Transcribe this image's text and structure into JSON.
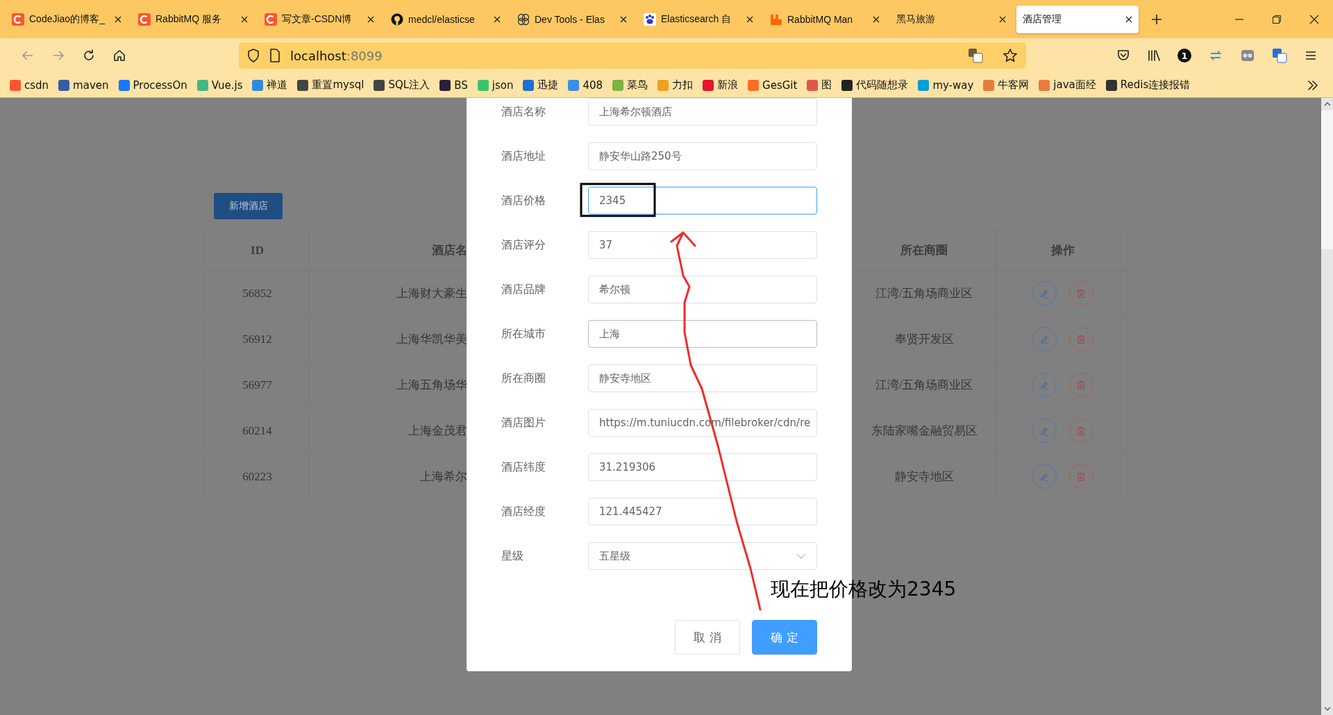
{
  "browser": {
    "tabs": [
      {
        "title": "CodeJiao的博客_",
        "kind": "csdn",
        "selected": false
      },
      {
        "title": "RabbitMQ 服务",
        "kind": "csdn",
        "selected": false
      },
      {
        "title": "写文章-CSDN博",
        "kind": "csdn",
        "selected": false
      },
      {
        "title": "medcl/elasticse",
        "kind": "github",
        "selected": false
      },
      {
        "title": "Dev Tools - Elas",
        "kind": "devtools",
        "selected": false
      },
      {
        "title": "Elasticsearch 自",
        "kind": "baidu",
        "selected": false
      },
      {
        "title": "RabbitMQ Man",
        "kind": "rabbit",
        "selected": false
      },
      {
        "title": "黑马旅游",
        "kind": "plain",
        "selected": false
      },
      {
        "title": "酒店管理",
        "kind": "plain",
        "selected": true
      }
    ],
    "address": {
      "host": "localhost",
      "port": ":8099"
    },
    "toolbar_badge": "1",
    "bookmarks": [
      {
        "label": "csdn",
        "color": "#fc5531"
      },
      {
        "label": "maven",
        "color": "#3a5ca8"
      },
      {
        "label": "ProcessOn",
        "color": "#1677ff"
      },
      {
        "label": "Vue.js",
        "color": "#41b883"
      },
      {
        "label": "禅道",
        "color": "#2f8bd8"
      },
      {
        "label": "重置mysql",
        "color": "#444444"
      },
      {
        "label": "SQL注入",
        "color": "#444444"
      },
      {
        "label": "BS",
        "color": "#2a1f3d"
      },
      {
        "label": "json",
        "color": "#3ac46a"
      },
      {
        "label": "迅捷",
        "color": "#1f6fd0"
      },
      {
        "label": "408",
        "color": "#3b8ee6"
      },
      {
        "label": "菜鸟",
        "color": "#7cb342"
      },
      {
        "label": "力扣",
        "color": "#f0a020"
      },
      {
        "label": "新浪",
        "color": "#e6162d"
      },
      {
        "label": "GesGit",
        "color": "#fc6d26"
      },
      {
        "label": "图",
        "color": "#e0564e"
      },
      {
        "label": "代码随想录",
        "color": "#222222"
      },
      {
        "label": "my-way",
        "color": "#00a1d6"
      },
      {
        "label": "牛客网",
        "color": "#e87c3e"
      },
      {
        "label": "java面经",
        "color": "#e87c3e"
      },
      {
        "label": "Redis连接报错",
        "color": "#333333"
      }
    ]
  },
  "page": {
    "add_button": "新增酒店",
    "table": {
      "columns": [
        "ID",
        "酒店名",
        "所在商圈",
        "操作"
      ],
      "rows": [
        {
          "id": "56852",
          "name": "上海财大豪生",
          "area": "江湾/五角场商业区"
        },
        {
          "id": "56912",
          "name": "上海华凯华美",
          "area": "奉贤开发区"
        },
        {
          "id": "56977",
          "name": "上海五角场华",
          "area": "江湾/五角场商业区"
        },
        {
          "id": "60214",
          "name": "上海金茂君",
          "area": "东陆家嘴金融贸易区"
        },
        {
          "id": "60223",
          "name": "上海希尔",
          "area": "静安寺地区"
        }
      ]
    }
  },
  "dialog": {
    "fields": [
      {
        "label": "酒店名称",
        "kind": "input",
        "value": "上海希尔顿酒店",
        "focused": false,
        "hovered": false
      },
      {
        "label": "酒店地址",
        "kind": "input",
        "value": "静安华山路250号",
        "focused": false,
        "hovered": false
      },
      {
        "label": "酒店价格",
        "kind": "input",
        "value": "2345",
        "focused": true,
        "hovered": false
      },
      {
        "label": "酒店评分",
        "kind": "input",
        "value": "37",
        "focused": false,
        "hovered": false
      },
      {
        "label": "酒店品牌",
        "kind": "input",
        "value": "希尔顿",
        "focused": false,
        "hovered": false
      },
      {
        "label": "所在城市",
        "kind": "input",
        "value": "上海",
        "focused": false,
        "hovered": true
      },
      {
        "label": "所在商圈",
        "kind": "input",
        "value": "静安寺地区",
        "focused": false,
        "hovered": false
      },
      {
        "label": "酒店图片",
        "kind": "input",
        "value": "https://m.tuniucdn.com/filebroker/cdn/re",
        "focused": false,
        "hovered": false
      },
      {
        "label": "酒店纬度",
        "kind": "input",
        "value": "31.219306",
        "focused": false,
        "hovered": false
      },
      {
        "label": "酒店经度",
        "kind": "input",
        "value": "121.445427",
        "focused": false,
        "hovered": false
      },
      {
        "label": "星级",
        "kind": "select",
        "value": "五星级",
        "focused": false,
        "hovered": false
      }
    ],
    "buttons": [
      {
        "label": "取 消",
        "kind": "default"
      },
      {
        "label": "确 定",
        "kind": "primary"
      }
    ]
  },
  "annotation": {
    "text": "现在把价格改为2345"
  }
}
